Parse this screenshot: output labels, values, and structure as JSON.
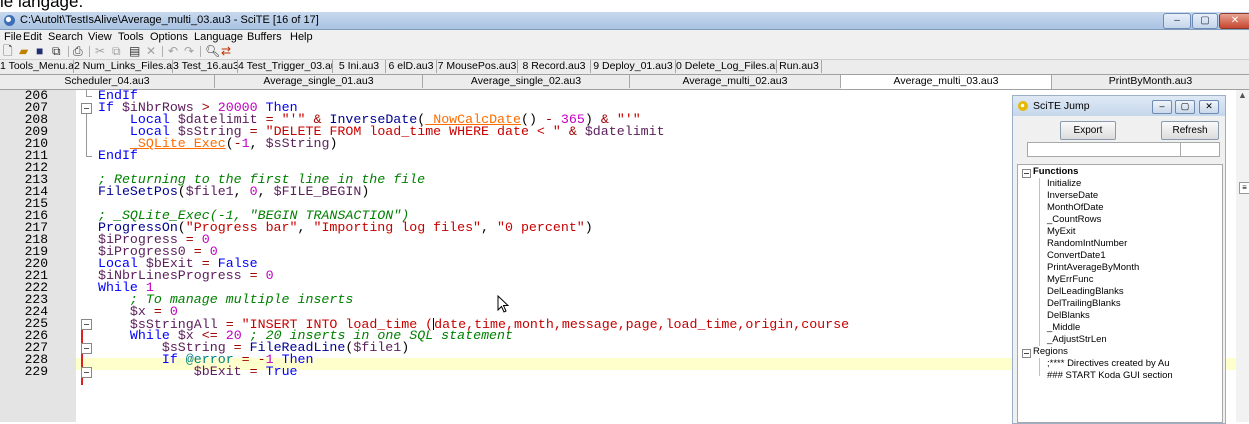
{
  "header_cut_text": "le langage.",
  "window": {
    "title": "C:\\Autolt\\TestIsAlive\\Average_multi_03.au3 - SciTE [16 of 17]",
    "min": "–",
    "max": "▢",
    "close": "✕"
  },
  "menu": [
    "File",
    "Edit",
    "Search",
    "View",
    "Tools",
    "Options",
    "Language",
    "Buffers",
    "Help"
  ],
  "toolbar": {
    "icons": [
      "new-file-icon",
      "open-folder-icon",
      "save-icon",
      "save-all-icon",
      "print-icon",
      "cut-icon",
      "copy-icon",
      "paste-icon",
      "delete-icon",
      "undo-icon",
      "redo-icon",
      "find-icon",
      "replace-icon"
    ]
  },
  "tabs_row1": [
    "1 Tools_Menu.au3",
    "2 Num_Links_Files.au3",
    "3 Test_16.au3",
    "4 Test_Trigger_03.au3",
    "5 Ini.au3",
    "6 elD.au3",
    "7 MousePos.au3",
    "8 Record.au3",
    "9 Deploy_01.au3",
    "0 Delete_Log_Files.au3",
    "Run.au3"
  ],
  "tabs_row2": [
    "Scheduler_04.au3",
    "Average_single_01.au3",
    "Average_single_02.au3",
    "Average_multi_02.au3",
    "Average_multi_03.au3",
    "PrintByMonth.au3"
  ],
  "active_tab": "Average_multi_03.au3",
  "line_numbers": [
    "206",
    "207",
    "208",
    "209",
    "210",
    "211",
    "212",
    "213",
    "214",
    "215",
    "216",
    "217",
    "218",
    "219",
    "220",
    "221",
    "222",
    "223",
    "224",
    "225",
    "226",
    "227",
    "228",
    "229"
  ],
  "current_line": "225",
  "scite_jump": {
    "title": "SciTE Jump",
    "export_label": "Export",
    "refresh_label": "Refresh",
    "functions_label": "Functions",
    "functions": [
      "Initialize",
      "InverseDate",
      "MonthOfDate",
      "_CountRows",
      "MyExit",
      "RandomIntNumber",
      "ConvertDate1",
      "PrintAverageByMonth",
      "MyErrFunc",
      "DelLeadingBlanks",
      "DelTrailingBlanks",
      "DelBlanks",
      "_Middle",
      "_AdjustStrLen"
    ],
    "regions_label": "Regions",
    "regions": [
      ";**** Directives created by Au",
      "### START Koda GUI section"
    ]
  },
  "colors": {
    "keyword": "#0000ff",
    "string": "#c80000",
    "comment": "#008000",
    "variable": "#5a1e5a",
    "number": "#c000c0",
    "udf": "#ff6c00",
    "current_line_bg": "#ffffcc"
  }
}
